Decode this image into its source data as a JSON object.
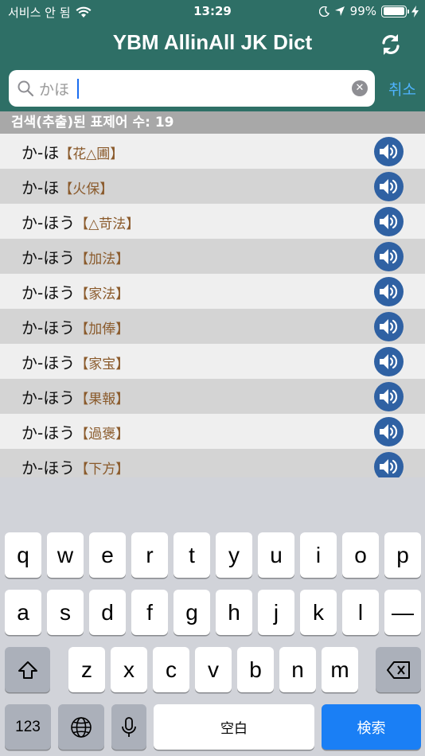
{
  "status": {
    "carrier": "서비스 안 됨",
    "time": "13:29",
    "battery": "99%",
    "battery_level": 0.99
  },
  "nav": {
    "title": "YBM AllinAll JK Dict",
    "refresh_icon": "refresh-icon"
  },
  "search": {
    "value": "かほ",
    "cancel_label": "취소"
  },
  "result_count": "검색(추출)된 표제어 수: 19",
  "results": [
    {
      "kana": "か-ほ",
      "kanji": "【花△圃】"
    },
    {
      "kana": "か-ほ",
      "kanji": "【火保】"
    },
    {
      "kana": "か-ほう",
      "kanji": "【△苛法】"
    },
    {
      "kana": "か-ほう",
      "kanji": "【加法】"
    },
    {
      "kana": "か-ほう",
      "kanji": "【家法】"
    },
    {
      "kana": "か-ほう",
      "kanji": "【加俸】"
    },
    {
      "kana": "か-ほう",
      "kanji": "【家宝】"
    },
    {
      "kana": "か-ほう",
      "kanji": "【果報】"
    },
    {
      "kana": "か-ほう",
      "kanji": "【過褒】"
    },
    {
      "kana": "か-ほう",
      "kanji": "【下方】"
    }
  ],
  "keyboard": {
    "row1": [
      "q",
      "w",
      "e",
      "r",
      "t",
      "y",
      "u",
      "i",
      "o",
      "p"
    ],
    "row2": [
      "a",
      "s",
      "d",
      "f",
      "g",
      "h",
      "j",
      "k",
      "l",
      "—"
    ],
    "row3": [
      "z",
      "x",
      "c",
      "v",
      "b",
      "n",
      "m"
    ],
    "numbers_label": "123",
    "space_label": "空白",
    "search_label": "検索"
  },
  "colors": {
    "header": "#2e6f66",
    "speaker": "#2f61a3",
    "kanji": "#8a5a2b",
    "cancel": "#4fb3ff",
    "search_key": "#1a7ff5"
  }
}
